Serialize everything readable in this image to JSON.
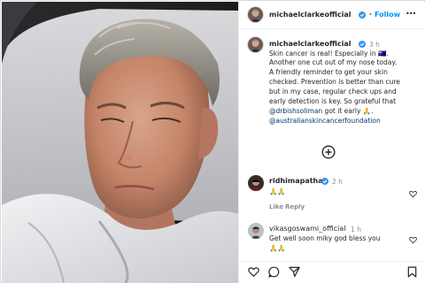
{
  "header": {
    "username": "michaelclarkeofficial",
    "separator": "•",
    "follow_label": "Follow",
    "more_label": "•••"
  },
  "caption": {
    "username": "michaelclarkeofficial",
    "time": "3 h",
    "lines": [
      "Skin cancer is real! Especially in 🇦🇺.",
      "Another one cut out of my nose today.",
      "A friendly reminder to get your skin",
      "checked. Prevention is better than cure",
      "but in my case, regular check ups and",
      "early detection is key. So grateful that"
    ],
    "mention1": "@drbishsoliman",
    "mention1_suffix": " got it early 🙏.",
    "mention2": "@australianskincancerfoundation"
  },
  "load_more_icon": "plus-circle-icon",
  "comments": [
    {
      "username": "ridhimapathak",
      "verified": true,
      "time": "2 h",
      "text": "🙏🙏",
      "like_label": "Like",
      "reply_label": "Reply"
    },
    {
      "username": "vikasgoswami_official",
      "verified": false,
      "time": "1 h",
      "text": "Get well soon miky god bless you",
      "text2": "🙏🙏"
    }
  ],
  "actions": [
    "heart-icon",
    "comment-icon",
    "share-icon",
    "bookmark-icon"
  ],
  "colors": {
    "accent": "#0095f6",
    "verified": "#3897f0",
    "link": "#00376b",
    "text": "#262626",
    "muted": "#8e8e8e"
  }
}
